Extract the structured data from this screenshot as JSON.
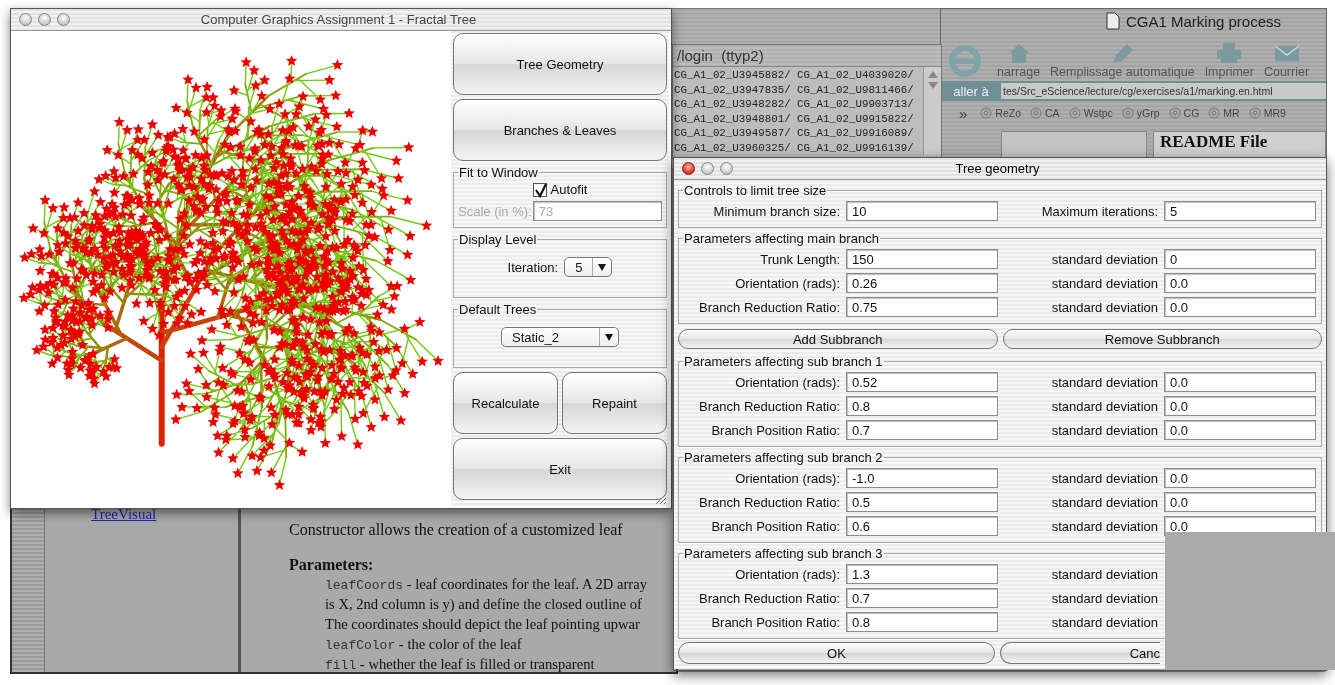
{
  "documentation": {
    "links": [
      "TreeVisual"
    ],
    "intro": "Constructor allows the creation of a customized leaf",
    "params_heading": "Parameters:",
    "params": [
      {
        "code": "leafCoords",
        "text": " - leaf coordinates for the leaf. A 2D array"
      },
      {
        "text": "is X, 2nd column is y) and define the closed outline of"
      },
      {
        "text": "The coordinates should depict the leaf pointing upwar"
      },
      {
        "code": "leafColor",
        "text": " - the color of the leaf"
      },
      {
        "code": "fill",
        "text": " - whether the leaf is filled or transparent"
      }
    ]
  },
  "browser": {
    "title": "CGA1 Marking process",
    "toolbar": [
      {
        "label": "narrage",
        "kind": "home"
      },
      {
        "label": "Remplissage automatique",
        "kind": "autofill"
      },
      {
        "label": "Imprimer",
        "kind": "print"
      },
      {
        "label": "Courrier",
        "kind": "mail"
      }
    ],
    "go_button": "aller à",
    "address": "tes/Src_eScience/lecture/cg/exercises/a1/marking.en.html",
    "overflow": "»",
    "bookmarks": [
      "ReZo",
      "CA",
      "Wstpc",
      "yGrp",
      "CG",
      "MR",
      "MR9"
    ],
    "heading": "README File"
  },
  "terminal": {
    "title": "/login  (ttyp2)",
    "lines": [
      "CG_A1_02_U3945882/ CG_A1_02_U4039020/",
      "CG_A1_02_U3947835/ CG_A1_02_U9811466/",
      "CG_A1_02_U3948282/ CG_A1_02_U9903713/",
      "CG_A1_02_U3948801/ CG_A1_02_U9915822/",
      "CG_A1_02_U3949587/ CG_A1_02_U9916089/",
      "CG_A1_02_U3960325/ CG_A1_02_U9916139/"
    ]
  },
  "fractal_window": {
    "title": "Computer Graphics Assignment 1 - Fractal Tree",
    "active": false,
    "top_buttons": [
      "Tree Geometry",
      "Branches & Leaves"
    ],
    "fit_to_window": {
      "title": "Fit to Window",
      "autofit": {
        "label": "Autofit",
        "checked": true
      },
      "scale": {
        "label": "Scale (in %):",
        "value": "73",
        "disabled": true
      }
    },
    "display_level": {
      "title": "Display Level",
      "label": "Iteration:",
      "value": "5"
    },
    "default_trees": {
      "title": "Default Trees",
      "value": "Static_2"
    },
    "action_buttons": [
      "Recalculate",
      "Repaint"
    ],
    "exit_button": "Exit"
  },
  "dialog": {
    "title": "Tree geometry",
    "active": true,
    "sections": [
      {
        "kind": "group",
        "title": "Controls to limit tree size",
        "rows": [
          [
            {
              "label": "Minimum branch size:",
              "value": "10"
            },
            {
              "label": "Maximum iterations:",
              "value": "5"
            }
          ]
        ]
      },
      {
        "kind": "group",
        "title": "Parameters affecting main branch",
        "rows": [
          [
            {
              "label": "Trunk Length:",
              "value": "150"
            },
            {
              "label": "standard deviation",
              "value": "0"
            }
          ],
          [
            {
              "label": "Orientation (rads):",
              "value": "0.26"
            },
            {
              "label": "standard deviation",
              "value": "0.0"
            }
          ],
          [
            {
              "label": "Branch Reduction Ratio:",
              "value": "0.75"
            },
            {
              "label": "standard deviation",
              "value": "0.0"
            }
          ]
        ]
      },
      {
        "kind": "buttons",
        "buttons": [
          "Add Subbranch",
          "Remove Subbranch"
        ]
      },
      {
        "kind": "group",
        "title": "Parameters affecting sub branch 1",
        "rows": [
          [
            {
              "label": "Orientation (rads):",
              "value": "0.52"
            },
            {
              "label": "standard deviation",
              "value": "0.0"
            }
          ],
          [
            {
              "label": "Branch Reduction Ratio:",
              "value": "0.8"
            },
            {
              "label": "standard deviation",
              "value": "0.0"
            }
          ],
          [
            {
              "label": "Branch Position Ratio:",
              "value": "0.7"
            },
            {
              "label": "standard deviation",
              "value": "0.0"
            }
          ]
        ]
      },
      {
        "kind": "group",
        "title": "Parameters affecting sub branch 2",
        "rows": [
          [
            {
              "label": "Orientation (rads):",
              "value": "-1.0"
            },
            {
              "label": "standard deviation",
              "value": "0.0"
            }
          ],
          [
            {
              "label": "Branch Reduction Ratio:",
              "value": "0.5"
            },
            {
              "label": "standard deviation",
              "value": "0.0"
            }
          ],
          [
            {
              "label": "Branch Position Ratio:",
              "value": "0.6"
            },
            {
              "label": "standard deviation",
              "value": "0.0"
            }
          ]
        ]
      },
      {
        "kind": "group",
        "title": "Parameters affecting sub branch 3",
        "rows": [
          [
            {
              "label": "Orientation (rads):",
              "value": "1.3"
            },
            {
              "label": "standard deviation"
            }
          ],
          [
            {
              "label": "Branch Reduction Ratio:",
              "value": "0.7"
            },
            {
              "label": "standard deviation"
            }
          ],
          [
            {
              "label": "Branch Position Ratio:",
              "value": "0.8"
            },
            {
              "label": "standard deviation"
            }
          ]
        ]
      }
    ],
    "footer_buttons": [
      "OK",
      "Canc"
    ]
  }
}
